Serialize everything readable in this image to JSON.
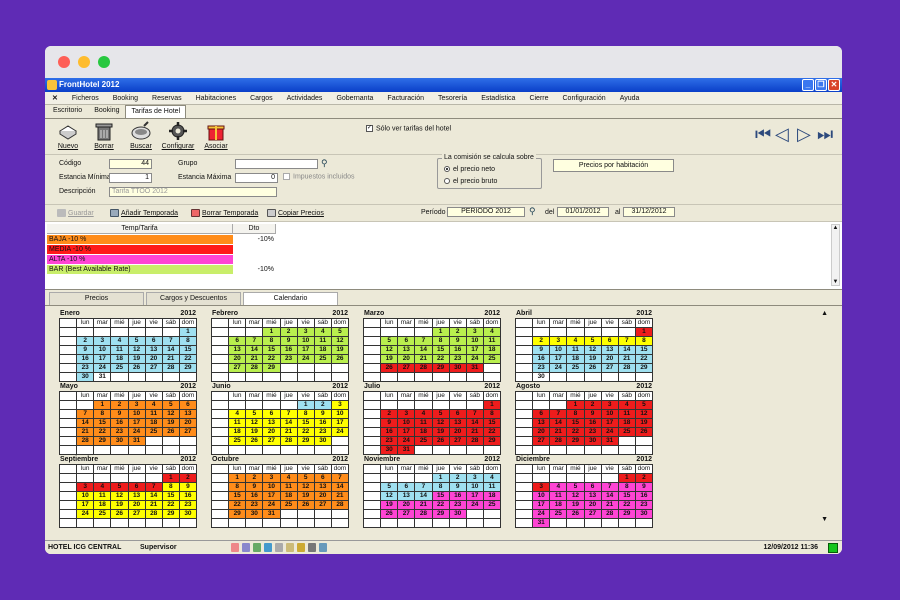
{
  "window": {
    "title": "FrontHotel 2012"
  },
  "menu": [
    "Ficheros",
    "Booking",
    "Reservas",
    "Habitaciones",
    "Cargos",
    "Actividades",
    "Gobernanta",
    "Facturación",
    "Tesorería",
    "Estadística",
    "Cierre",
    "Configuración",
    "Ayuda"
  ],
  "top_tabs": [
    {
      "label": "Escritorio"
    },
    {
      "label": "Booking"
    },
    {
      "label": "Tarifas de Hotel",
      "active": true
    }
  ],
  "toolbar": {
    "nuevo": "Nuevo",
    "borrar": "Borrar",
    "buscar": "Buscar",
    "configurar": "Configurar",
    "asociar": "Asociar",
    "solo_tarifas": "Sólo ver tarifas del hotel",
    "solo_tarifas_checked": true
  },
  "form": {
    "codigo_label": "Código",
    "codigo": "44",
    "grupo_label": "Grupo",
    "grupo": "",
    "estancia_min_label": "Estancia Mínima",
    "estancia_min": "1",
    "estancia_max_label": "Estancia Máxima",
    "estancia_max": "0",
    "impuestos_label": "Impuestos incluidos",
    "descripcion_label": "Descripción",
    "descripcion": "Tarifa TTOO 2012",
    "comision_title": "La comisión se calcula sobre",
    "opt_neto": "el precio neto",
    "opt_bruto": "el precio bruto",
    "precios_hab": "Precios por habitación"
  },
  "actions": {
    "guardar": "Guardar",
    "anadir": "Añadir Temporada",
    "borrar": "Borrar Temporada",
    "copiar": "Copiar Precios",
    "periodo_label": "Período",
    "periodo": "PERIODO 2012",
    "del_label": "del",
    "del": "01/01/2012",
    "al_label": "al",
    "al": "31/12/2012"
  },
  "temp_table": {
    "headers": [
      "Temp/Tarifa",
      "Dto"
    ],
    "rows": [
      {
        "name": "BAJA -10 %",
        "dto": "-10%",
        "color": "#ff8c1a"
      },
      {
        "name": "MEDIA -10 %",
        "dto": "",
        "color": "#ff1a1a"
      },
      {
        "name": "ALTA -10 %",
        "dto": "",
        "color": "#ff44d4"
      },
      {
        "name": "BAR (Best Available Rate)",
        "dto": "-10%",
        "color": "#c9ee6a"
      }
    ]
  },
  "bottom_tabs": [
    {
      "label": "Precios"
    },
    {
      "label": "Cargos y Descuentos"
    },
    {
      "label": "Calendario",
      "active": true
    }
  ],
  "calendar": {
    "year": "2012",
    "weekdays": [
      "lun",
      "mar",
      "mié",
      "jue",
      "vie",
      "sáb",
      "dom"
    ],
    "colors": {
      "O": "#ff8c1a",
      "R": "#ee1c1c",
      "P": "#ff44d4",
      "G": "#b9ef4e",
      "Y": "#ffff00",
      "C": "#9fe0f0"
    },
    "months": [
      {
        "name": "Enero",
        "start": 6,
        "days": 31,
        "colors": "CCCCCCCCCCCCCCCCCCCCCCCCCCCCCCW"
      },
      {
        "name": "Febrero",
        "start": 2,
        "days": 29,
        "colors": "GGGGGGGGGGGGGGGGGGGGGGGGGGGGG"
      },
      {
        "name": "Marzo",
        "start": 3,
        "days": 31,
        "colors": "GGGGGGGGGGGGGGGGGGGGGGGGGRRRRRR"
      },
      {
        "name": "Abril",
        "start": 6,
        "days": 30,
        "colors": "RYYYYYYYCCCCCCCCCCCCCCCCCCCCCW"
      },
      {
        "name": "Mayo",
        "start": 1,
        "days": 31,
        "colors": "OOOOOOOOOOOOOOOOOOOOOOOOOOOOOOO"
      },
      {
        "name": "Junio",
        "start": 4,
        "days": 30,
        "colors": "CCYYYYYYYYYYYYYYYYYYYYYYYYYYYY"
      },
      {
        "name": "Julio",
        "start": 6,
        "days": 31,
        "colors": "RRRRRRRRRRRRRRRRRRRRRRRRRRRRRRR"
      },
      {
        "name": "Agosto",
        "start": 2,
        "days": 31,
        "colors": "RRRRRRRRRRRRRRRRRRRRRRRRRRRRRRR"
      },
      {
        "name": "Septiembre",
        "start": 5,
        "days": 30,
        "colors": "RRRRRRRYYYYYYYYYYYYYYYYYYYYYYY"
      },
      {
        "name": "Octubre",
        "start": 0,
        "days": 31,
        "colors": "OOOOOOOOOOOOOOOOOOOOOOOOOOOOOOO"
      },
      {
        "name": "Noviembre",
        "start": 3,
        "days": 30,
        "colors": "CCCCCCCCCCCCCCPPPPPPPPPPPPPPPP"
      },
      {
        "name": "Diciembre",
        "start": 5,
        "days": 31,
        "colors": "RRRPPPPPPPPPPPPPPPPPPPPPPPPPPPP"
      }
    ]
  },
  "status": {
    "hotel": "HOTEL ICG CENTRAL",
    "user": "Supervisor",
    "datetime": "12/09/2012   11:36"
  }
}
